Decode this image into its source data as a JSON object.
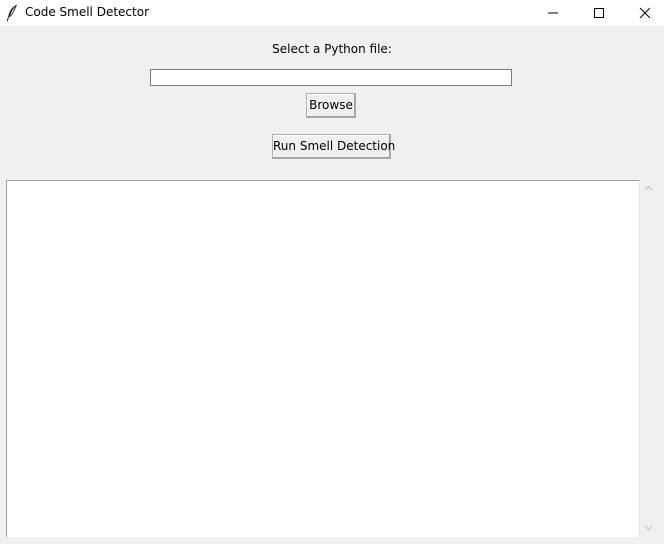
{
  "window": {
    "title": "Code Smell Detector",
    "app_icon": "feather-icon",
    "controls": {
      "minimize_icon": "minimize-icon",
      "maximize_icon": "maximize-icon",
      "close_icon": "close-icon"
    }
  },
  "form": {
    "file_label": "Select a Python file:",
    "file_path_value": "",
    "browse_label": "Browse",
    "run_label": "Run Smell Detection"
  },
  "output": {
    "text": "",
    "scrollbar": {
      "up_icon": "scroll-up-arrow-icon",
      "down_icon": "scroll-down-arrow-icon"
    }
  },
  "colors": {
    "window_background": "#f0f0f0",
    "titlebar_background": "#ffffff",
    "text_area_background": "#ffffff"
  }
}
